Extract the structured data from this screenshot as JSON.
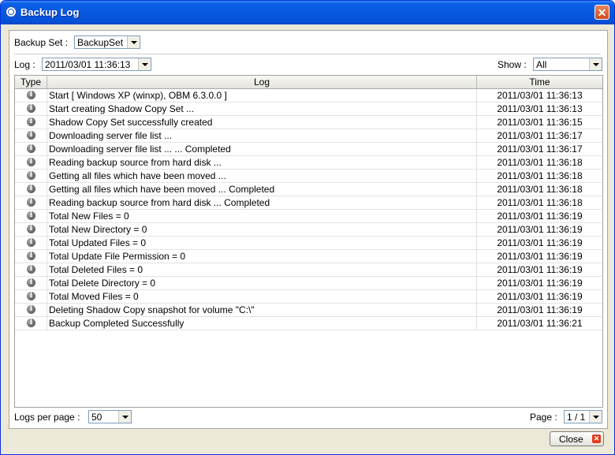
{
  "window": {
    "title": "Backup Log",
    "close_glyph": "✕"
  },
  "filters": {
    "backup_set_label": "Backup Set :",
    "backup_set_value": "BackupSet",
    "log_label": "Log :",
    "log_value": "2011/03/01 11:36:13",
    "show_label": "Show :",
    "show_value": "All"
  },
  "table": {
    "columns": {
      "type": "Type",
      "log": "Log",
      "time": "Time"
    },
    "rows": [
      {
        "log": "Start [ Windows XP (winxp), OBM 6.3.0.0 ]",
        "time": "2011/03/01 11:36:13"
      },
      {
        "log": "Start creating Shadow Copy Set ...",
        "time": "2011/03/01 11:36:13"
      },
      {
        "log": "Shadow Copy Set successfully created",
        "time": "2011/03/01 11:36:15"
      },
      {
        "log": "Downloading server file list ...",
        "time": "2011/03/01 11:36:17"
      },
      {
        "log": "Downloading server file list ... ... Completed",
        "time": "2011/03/01 11:36:17"
      },
      {
        "log": "Reading backup source from hard disk ...",
        "time": "2011/03/01 11:36:18"
      },
      {
        "log": "Getting all files which have been moved ...",
        "time": "2011/03/01 11:36:18"
      },
      {
        "log": "Getting all files which have been moved ... Completed",
        "time": "2011/03/01 11:36:18"
      },
      {
        "log": "Reading backup source from hard disk ... Completed",
        "time": "2011/03/01 11:36:18"
      },
      {
        "log": "Total New Files = 0",
        "time": "2011/03/01 11:36:19"
      },
      {
        "log": "Total New Directory = 0",
        "time": "2011/03/01 11:36:19"
      },
      {
        "log": "Total Updated Files = 0",
        "time": "2011/03/01 11:36:19"
      },
      {
        "log": "Total Update File Permission = 0",
        "time": "2011/03/01 11:36:19"
      },
      {
        "log": "Total Deleted Files = 0",
        "time": "2011/03/01 11:36:19"
      },
      {
        "log": "Total Delete Directory = 0",
        "time": "2011/03/01 11:36:19"
      },
      {
        "log": "Total Moved Files = 0",
        "time": "2011/03/01 11:36:19"
      },
      {
        "log": "Deleting Shadow Copy snapshot for volume \"C:\\\"",
        "time": "2011/03/01 11:36:19"
      },
      {
        "log": "Backup Completed Successfully",
        "time": "2011/03/01 11:36:21"
      }
    ],
    "row_icon": "info-icon",
    "row_icon_glyph": "i"
  },
  "footer": {
    "logs_per_page_label": "Logs per page :",
    "logs_per_page_value": "50",
    "page_label": "Page :",
    "page_value": "1 / 1"
  },
  "buttons": {
    "close_label": "Close",
    "close_icon_glyph": "✕"
  }
}
